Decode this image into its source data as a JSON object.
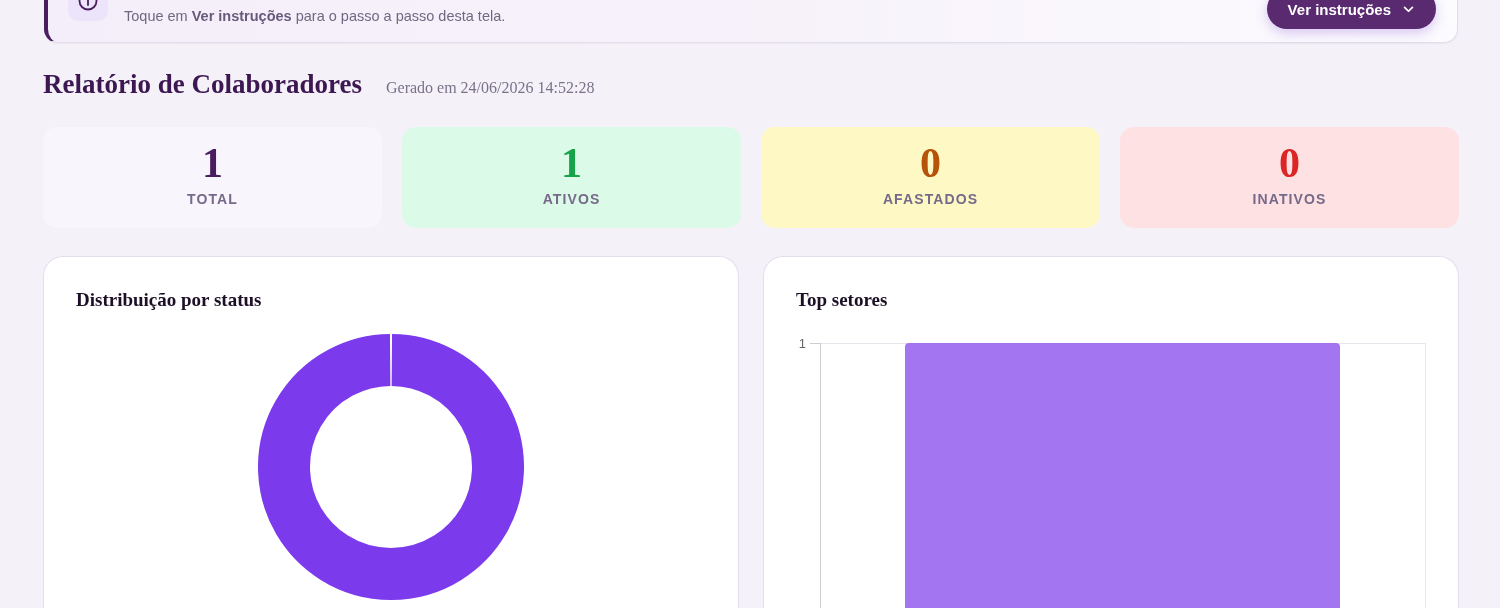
{
  "banner": {
    "text": "Toque em **Ver instruções** para o passo a passo desta tela.",
    "button": "Ver instruções"
  },
  "report": {
    "title": "Relatório de Colaboradores",
    "generated": "Gerado em 24/06/2026 14:52:28"
  },
  "stats": [
    {
      "kind": "total",
      "value": "1",
      "label": "TOTAL"
    },
    {
      "kind": "active",
      "value": "1",
      "label": "ATIVOS"
    },
    {
      "kind": "away",
      "value": "0",
      "label": "AFASTADOS"
    },
    {
      "kind": "inactive",
      "value": "0",
      "label": "INATIVOS"
    }
  ],
  "charts": [
    {
      "kind": "donut",
      "title": "Distribuição por status"
    },
    {
      "kind": "bar",
      "title": "Top setores",
      "y_tick_labels": [
        "1"
      ]
    }
  ]
}
